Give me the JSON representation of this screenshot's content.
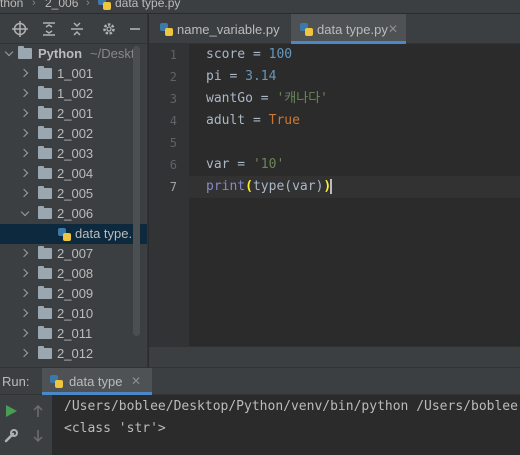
{
  "breadcrumb": {
    "project": "thon",
    "folder": "2_006",
    "file": "data type.py"
  },
  "toolbar": {
    "icons": [
      "crosshair-icon",
      "expand-all-icon",
      "collapse-all-icon",
      "gear-icon",
      "hide-icon"
    ]
  },
  "project": {
    "root": {
      "name": "Python",
      "path": "~/Deskt"
    },
    "folders": [
      "1_001",
      "1_002",
      "2_001",
      "2_002",
      "2_003",
      "2_004",
      "2_005",
      "2_006",
      "2_007",
      "2_008",
      "2_009",
      "2_010",
      "2_011",
      "2_012"
    ],
    "open_folder": "2_006",
    "selected_file": "data type."
  },
  "editor": {
    "tabs": [
      {
        "label": "name_variable.py",
        "active": false
      },
      {
        "label": "data type.py",
        "active": true
      }
    ],
    "line_numbers": [
      "1",
      "2",
      "3",
      "4",
      "5",
      "6",
      "7"
    ],
    "current_line": 7,
    "code": {
      "l1": {
        "var": "score",
        "op": " = ",
        "val": "100"
      },
      "l2": {
        "var": "pi",
        "op": " = ",
        "val": "3.14"
      },
      "l3": {
        "var": "wantGo",
        "op": " = ",
        "val": "'캐나다'"
      },
      "l4": {
        "var": "adult",
        "op": " = ",
        "val": "True"
      },
      "l6": {
        "var": "var",
        "op": " = ",
        "val": "'10'"
      },
      "l7": {
        "fn": "print",
        "open": "(",
        "inner": "type(var)",
        "close": ")"
      }
    }
  },
  "run": {
    "title": "Run:",
    "tab_label": "data type",
    "output": [
      "/Users/boblee/Desktop/Python/venv/bin/python /Users/boblee",
      "<class 'str'>"
    ]
  },
  "colors": {
    "number": "#6897bb",
    "string": "#6a8759",
    "keyword": "#cc7832",
    "builtin": "#8888c6",
    "accent": "#4a88c7"
  }
}
